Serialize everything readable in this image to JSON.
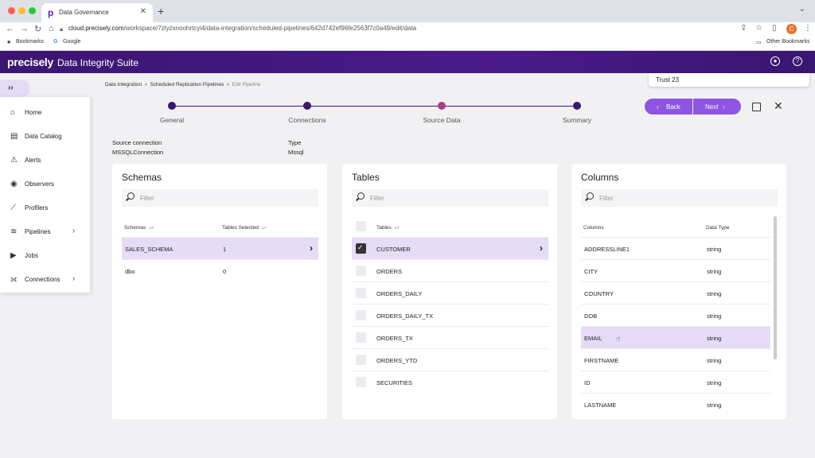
{
  "browser": {
    "tab_title": "Data Governance",
    "url_domain": "cloud.precisely.com",
    "url_path": "/workspace/7zlyzxnoohrtcyi4/data-integration/scheduled-pipelines/642d742ef96fe2563f7c0a49/edit/data",
    "bookmarks": [
      "Bookmarks",
      "Google"
    ],
    "other_bookmarks": "Other Bookmarks",
    "profile_initial": "C"
  },
  "app": {
    "brand": "precisely",
    "suite": "Data Integrity Suite"
  },
  "trust": "Trust 23",
  "sidebar": {
    "items": [
      {
        "label": "Home",
        "icon": "home-icon"
      },
      {
        "label": "Data Catalog",
        "icon": "catalog-icon"
      },
      {
        "label": "Alerts",
        "icon": "alert-icon"
      },
      {
        "label": "Observers",
        "icon": "eye-icon"
      },
      {
        "label": "Profilers",
        "icon": "chart-line-icon"
      },
      {
        "label": "Pipelines",
        "icon": "pipelines-icon",
        "chevron": true
      },
      {
        "label": "Jobs",
        "icon": "play-icon"
      },
      {
        "label": "Connections",
        "icon": "connections-icon",
        "chevron": true
      }
    ]
  },
  "breadcrumb": [
    "Data Integration",
    "Scheduled Replication Pipelines",
    "Edit Pipeline"
  ],
  "stepper": [
    "General",
    "Connections",
    "Source Data",
    "Summary"
  ],
  "actions": {
    "back": "Back",
    "next": "Next"
  },
  "source": {
    "conn_label": "Source connection",
    "conn_value": "MSSQLConnection",
    "type_label": "Type",
    "type_value": "Mssql"
  },
  "schemas": {
    "title": "Schemas",
    "filter_placeholder": "Filter",
    "col1": "Schemas",
    "col2": "Tables Selected",
    "rows": [
      {
        "name": "SALES_SCHEMA",
        "count": "1"
      },
      {
        "name": "dbo",
        "count": "0"
      }
    ]
  },
  "tables": {
    "title": "Tables",
    "filter_placeholder": "Filter",
    "col1": "Tables",
    "rows": [
      "CUSTOMER",
      "ORDERS",
      "ORDERS_DAILY",
      "ORDERS_DAILY_TX",
      "ORDERS_TX",
      "ORDERS_YTD",
      "SECURITIES"
    ]
  },
  "columns": {
    "title": "Columns",
    "filter_placeholder": "Filter",
    "col1": "Columns",
    "col2": "Data Type",
    "rows": [
      {
        "name": "ADDRESSLINE1",
        "type": "string"
      },
      {
        "name": "CITY",
        "type": "string"
      },
      {
        "name": "COUNTRY",
        "type": "string"
      },
      {
        "name": "DOB",
        "type": "string"
      },
      {
        "name": "EMAIL",
        "type": "string"
      },
      {
        "name": "FIRSTNAME",
        "type": "string"
      },
      {
        "name": "ID",
        "type": "string"
      },
      {
        "name": "LASTNAME",
        "type": "string"
      }
    ]
  },
  "colors": {
    "brand": "#3a1670",
    "accent": "#8f55e2",
    "selected": "#e6dcf7",
    "active_step": "#b03a8a"
  }
}
